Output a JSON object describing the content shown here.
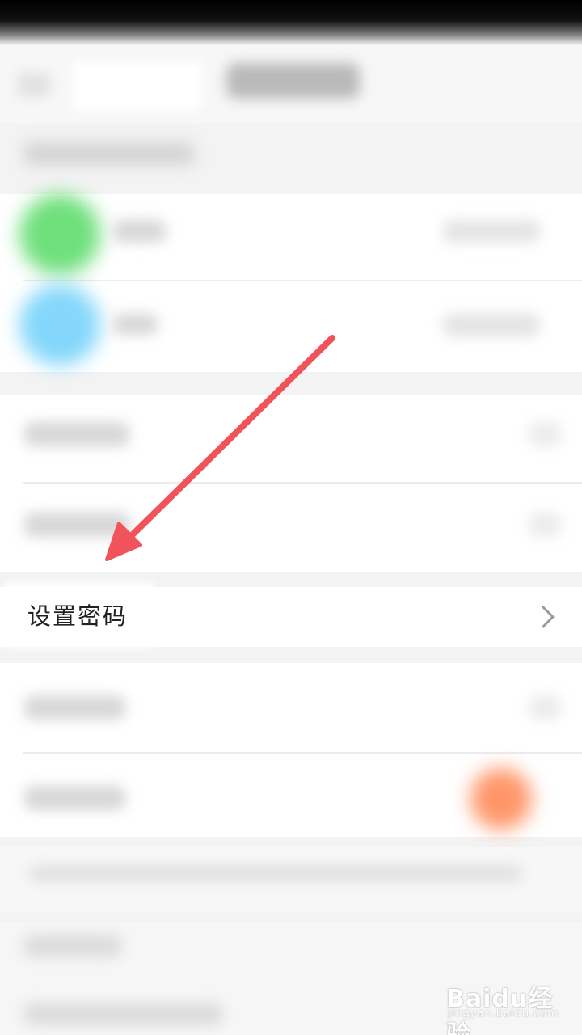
{
  "settings_row": {
    "label": "设置密码"
  },
  "watermark": {
    "brand": "Baidu经验",
    "url": "jingyan.baidu.com"
  },
  "icons": {
    "row_chevron": "chevron-right-icon",
    "annotation": "red-arrow-annotation"
  },
  "colors": {
    "annotation_arrow": "#f0545a",
    "chevron": "#9a9a9a",
    "label_text": "#222222",
    "green_avatar": "#6fe07c",
    "blue_avatar": "#84d7fb",
    "orange_toggle": "#ff9669"
  }
}
